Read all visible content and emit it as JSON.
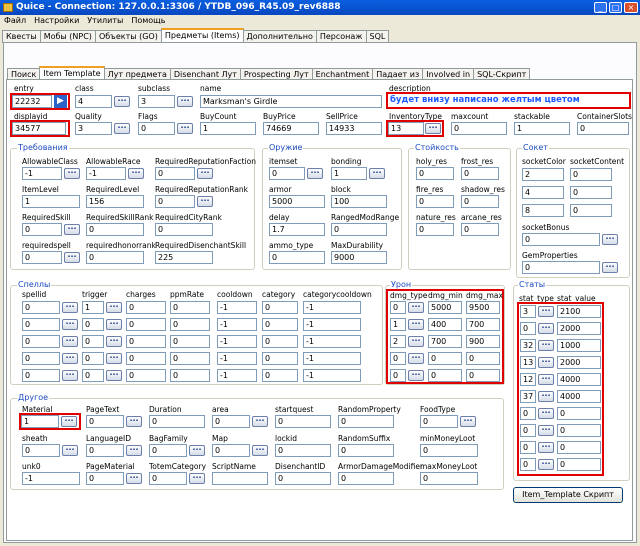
{
  "window": {
    "title": "Quice - Connection: 127.0.0.1:3306 / YTDB_096_R45.09_rev6888"
  },
  "menu": [
    "Файл",
    "Настройки",
    "Утилиты",
    "Помощь"
  ],
  "main_tabs": [
    "Квесты",
    "Мобы (NPC)",
    "Объекты (GO)",
    "Предметы (Items)",
    "Дополнительно",
    "Персонаж",
    "SQL"
  ],
  "sub_tabs": [
    "Поиск",
    "Item Template",
    "Лут предмета",
    "Disenchant Лут",
    "Prospecting Лут",
    "Enchantment",
    "Падает из",
    "Involved in",
    "SQL-Скрипт"
  ],
  "top": {
    "entry_l": "entry",
    "entry": "22232",
    "class_l": "class",
    "class": "4",
    "subclass_l": "subclass",
    "subclass": "3",
    "name_l": "name",
    "name": "Marksman's Girdle",
    "desc_l": "description",
    "desc": "будет внизу написано желтым цветом",
    "displayid_l": "displayid",
    "displayid": "34577",
    "quality_l": "Quality",
    "quality": "3",
    "flags_l": "Flags",
    "flags": "0",
    "buycount_l": "BuyCount",
    "buycount": "1",
    "buyprice_l": "BuyPrice",
    "buyprice": "74669",
    "sellprice_l": "SellPrice",
    "sellprice": "14933",
    "invtype_l": "InventoryType",
    "invtype": "13",
    "maxcount_l": "maxcount",
    "maxcount": "0",
    "stackable_l": "stackable",
    "stackable": "1",
    "slots_l": "ContainerSlots",
    "slots": "0"
  },
  "req": {
    "title": "Требования",
    "allowclass_l": "AllowableClass",
    "allowclass": "-1",
    "allowrace_l": "AllowableRace",
    "allowrace": "-1",
    "repfaction_l": "RequiredReputationFaction",
    "repfaction": "0",
    "itemlevel_l": "ItemLevel",
    "itemlevel": "1",
    "reqlevel_l": "RequiredLevel",
    "reqlevel": "156",
    "reprank_l": "RequiredReputationRank",
    "reprank": "0",
    "reqskill_l": "RequiredSkill",
    "reqskill": "0",
    "skillrank_l": "RequiredSkillRank",
    "skillrank": "0",
    "reqcity_l": "RequiredCityRank",
    "reqcity": "0",
    "reqspell_l": "requiredspell",
    "reqspell": "0",
    "honor_l": "requiredhonorrank",
    "honor": "0",
    "disench_l": "RequiredDisenchantSkill",
    "disench": "225"
  },
  "weapon": {
    "title": "Оружие",
    "itemset_l": "itemset",
    "itemset": "0",
    "bonding_l": "bonding",
    "bonding": "1",
    "armor_l": "armor",
    "armor": "5000",
    "block_l": "block",
    "block": "100",
    "delay_l": "delay",
    "delay": "1.7",
    "ranged_l": "RangedModRange",
    "ranged": "0",
    "ammo_l": "ammo_type",
    "ammo": "0",
    "maxdur_l": "MaxDurability",
    "maxdur": "9000"
  },
  "resist": {
    "title": "Стойкость",
    "holy_l": "holy_res",
    "holy": "0",
    "frost_l": "frost_res",
    "frost": "0",
    "fire_l": "fire_res",
    "fire": "0",
    "shadow_l": "shadow_res",
    "shadow": "0",
    "nature_l": "nature_res",
    "nature": "0",
    "arcane_l": "arcane_res",
    "arcane": "0"
  },
  "socket": {
    "title": "Сокет",
    "color_l": "socketColor",
    "content_l": "socketContent",
    "rows": [
      [
        "2",
        "0"
      ],
      [
        "4",
        "0"
      ],
      [
        "8",
        "0"
      ]
    ],
    "bonus_l": "socketBonus",
    "bonus": "0",
    "gem_l": "GemProperties",
    "gem": "0"
  },
  "spells": {
    "title": "Спеллы",
    "headers": [
      "spellid",
      "trigger",
      "charges",
      "ppmRate",
      "cooldown",
      "category",
      "categorycooldown"
    ],
    "rows": [
      [
        "0",
        "1",
        "0",
        "0",
        "-1",
        "0",
        "-1"
      ],
      [
        "0",
        "0",
        "0",
        "0",
        "-1",
        "0",
        "-1"
      ],
      [
        "0",
        "0",
        "0",
        "0",
        "-1",
        "0",
        "-1"
      ],
      [
        "0",
        "0",
        "0",
        "0",
        "-1",
        "0",
        "-1"
      ],
      [
        "0",
        "0",
        "0",
        "0",
        "-1",
        "0",
        "-1"
      ]
    ]
  },
  "damage": {
    "title": "Урон",
    "headers": [
      "dmg_type",
      "dmg_min",
      "dmg_max"
    ],
    "rows": [
      [
        "0",
        "5000",
        "9500"
      ],
      [
        "1",
        "400",
        "700"
      ],
      [
        "2",
        "700",
        "900"
      ],
      [
        "0",
        "0",
        "0"
      ],
      [
        "0",
        "0",
        "0"
      ]
    ]
  },
  "stats": {
    "title": "Статы",
    "headers": [
      "stat_type",
      "stat_value"
    ],
    "rows": [
      [
        "3",
        "2100"
      ],
      [
        "0",
        "2000"
      ],
      [
        "32",
        "1000"
      ],
      [
        "13",
        "2000"
      ],
      [
        "12",
        "4000"
      ],
      [
        "37",
        "4000"
      ],
      [
        "0",
        "0"
      ],
      [
        "0",
        "0"
      ],
      [
        "0",
        "0"
      ],
      [
        "0",
        "0"
      ]
    ]
  },
  "other": {
    "title": "Другое",
    "material_l": "Material",
    "material": "1",
    "pagetext_l": "PageText",
    "pagetext": "0",
    "duration_l": "Duration",
    "duration": "0",
    "area_l": "area",
    "area": "0",
    "startquest_l": "startquest",
    "startquest": "0",
    "randprop_l": "RandomProperty",
    "randprop": "0",
    "foodtype_l": "FoodType",
    "foodtype": "0",
    "sheath_l": "sheath",
    "sheath": "0",
    "lang_l": "LanguageID",
    "lang": "0",
    "bag_l": "BagFamily",
    "bag": "0",
    "map_l": "Map",
    "map": "0",
    "lockid_l": "lockid",
    "lockid": "0",
    "randsuf_l": "RandomSuffix",
    "randsuf": "0",
    "minmoney_l": "minMoneyLoot",
    "minmoney": "0",
    "unk0_l": "unk0",
    "unk0": "-1",
    "pagemat_l": "PageMaterial",
    "pagemat": "0",
    "totem_l": "TotemCategory",
    "totem": "0",
    "script_l": "ScriptName",
    "script": "",
    "disid_l": "DisenchantID",
    "disid": "0",
    "armordmg_l": "ArmorDamageModifier",
    "armordmg": "0",
    "maxmoney_l": "maxMoneyLoot",
    "maxmoney": "0"
  },
  "script_button": "Item_Template Скрипт"
}
